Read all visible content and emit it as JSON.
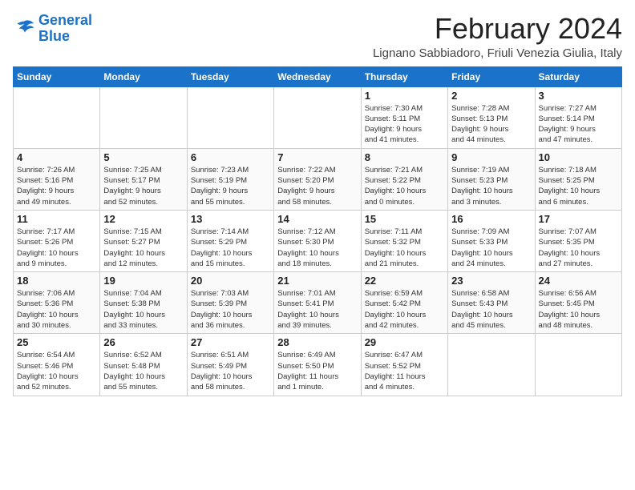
{
  "logo": {
    "line1": "General",
    "line2": "Blue"
  },
  "title": "February 2024",
  "subtitle": "Lignano Sabbiadoro, Friuli Venezia Giulia, Italy",
  "weekdays": [
    "Sunday",
    "Monday",
    "Tuesday",
    "Wednesday",
    "Thursday",
    "Friday",
    "Saturday"
  ],
  "weeks": [
    [
      {
        "day": "",
        "info": ""
      },
      {
        "day": "",
        "info": ""
      },
      {
        "day": "",
        "info": ""
      },
      {
        "day": "",
        "info": ""
      },
      {
        "day": "1",
        "info": "Sunrise: 7:30 AM\nSunset: 5:11 PM\nDaylight: 9 hours\nand 41 minutes."
      },
      {
        "day": "2",
        "info": "Sunrise: 7:28 AM\nSunset: 5:13 PM\nDaylight: 9 hours\nand 44 minutes."
      },
      {
        "day": "3",
        "info": "Sunrise: 7:27 AM\nSunset: 5:14 PM\nDaylight: 9 hours\nand 47 minutes."
      }
    ],
    [
      {
        "day": "4",
        "info": "Sunrise: 7:26 AM\nSunset: 5:16 PM\nDaylight: 9 hours\nand 49 minutes."
      },
      {
        "day": "5",
        "info": "Sunrise: 7:25 AM\nSunset: 5:17 PM\nDaylight: 9 hours\nand 52 minutes."
      },
      {
        "day": "6",
        "info": "Sunrise: 7:23 AM\nSunset: 5:19 PM\nDaylight: 9 hours\nand 55 minutes."
      },
      {
        "day": "7",
        "info": "Sunrise: 7:22 AM\nSunset: 5:20 PM\nDaylight: 9 hours\nand 58 minutes."
      },
      {
        "day": "8",
        "info": "Sunrise: 7:21 AM\nSunset: 5:22 PM\nDaylight: 10 hours\nand 0 minutes."
      },
      {
        "day": "9",
        "info": "Sunrise: 7:19 AM\nSunset: 5:23 PM\nDaylight: 10 hours\nand 3 minutes."
      },
      {
        "day": "10",
        "info": "Sunrise: 7:18 AM\nSunset: 5:25 PM\nDaylight: 10 hours\nand 6 minutes."
      }
    ],
    [
      {
        "day": "11",
        "info": "Sunrise: 7:17 AM\nSunset: 5:26 PM\nDaylight: 10 hours\nand 9 minutes."
      },
      {
        "day": "12",
        "info": "Sunrise: 7:15 AM\nSunset: 5:27 PM\nDaylight: 10 hours\nand 12 minutes."
      },
      {
        "day": "13",
        "info": "Sunrise: 7:14 AM\nSunset: 5:29 PM\nDaylight: 10 hours\nand 15 minutes."
      },
      {
        "day": "14",
        "info": "Sunrise: 7:12 AM\nSunset: 5:30 PM\nDaylight: 10 hours\nand 18 minutes."
      },
      {
        "day": "15",
        "info": "Sunrise: 7:11 AM\nSunset: 5:32 PM\nDaylight: 10 hours\nand 21 minutes."
      },
      {
        "day": "16",
        "info": "Sunrise: 7:09 AM\nSunset: 5:33 PM\nDaylight: 10 hours\nand 24 minutes."
      },
      {
        "day": "17",
        "info": "Sunrise: 7:07 AM\nSunset: 5:35 PM\nDaylight: 10 hours\nand 27 minutes."
      }
    ],
    [
      {
        "day": "18",
        "info": "Sunrise: 7:06 AM\nSunset: 5:36 PM\nDaylight: 10 hours\nand 30 minutes."
      },
      {
        "day": "19",
        "info": "Sunrise: 7:04 AM\nSunset: 5:38 PM\nDaylight: 10 hours\nand 33 minutes."
      },
      {
        "day": "20",
        "info": "Sunrise: 7:03 AM\nSunset: 5:39 PM\nDaylight: 10 hours\nand 36 minutes."
      },
      {
        "day": "21",
        "info": "Sunrise: 7:01 AM\nSunset: 5:41 PM\nDaylight: 10 hours\nand 39 minutes."
      },
      {
        "day": "22",
        "info": "Sunrise: 6:59 AM\nSunset: 5:42 PM\nDaylight: 10 hours\nand 42 minutes."
      },
      {
        "day": "23",
        "info": "Sunrise: 6:58 AM\nSunset: 5:43 PM\nDaylight: 10 hours\nand 45 minutes."
      },
      {
        "day": "24",
        "info": "Sunrise: 6:56 AM\nSunset: 5:45 PM\nDaylight: 10 hours\nand 48 minutes."
      }
    ],
    [
      {
        "day": "25",
        "info": "Sunrise: 6:54 AM\nSunset: 5:46 PM\nDaylight: 10 hours\nand 52 minutes."
      },
      {
        "day": "26",
        "info": "Sunrise: 6:52 AM\nSunset: 5:48 PM\nDaylight: 10 hours\nand 55 minutes."
      },
      {
        "day": "27",
        "info": "Sunrise: 6:51 AM\nSunset: 5:49 PM\nDaylight: 10 hours\nand 58 minutes."
      },
      {
        "day": "28",
        "info": "Sunrise: 6:49 AM\nSunset: 5:50 PM\nDaylight: 11 hours\nand 1 minute."
      },
      {
        "day": "29",
        "info": "Sunrise: 6:47 AM\nSunset: 5:52 PM\nDaylight: 11 hours\nand 4 minutes."
      },
      {
        "day": "",
        "info": ""
      },
      {
        "day": "",
        "info": ""
      }
    ]
  ]
}
